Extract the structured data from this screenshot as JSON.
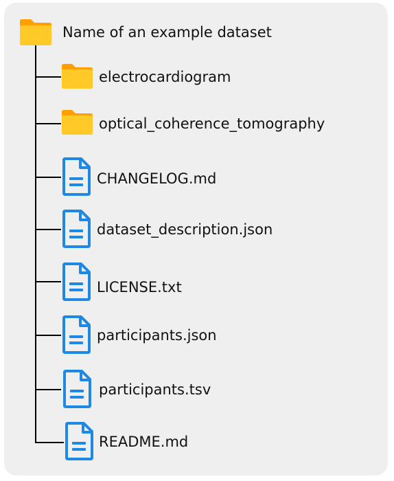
{
  "root": {
    "label": "Name of an example dataset",
    "icon": "folder-icon"
  },
  "entries": [
    {
      "label": "electrocardiogram",
      "icon": "folder-icon"
    },
    {
      "label": "optical_coherence_tomography",
      "icon": "folder-icon"
    },
    {
      "label": "CHANGELOG.md",
      "icon": "document-icon"
    },
    {
      "label": "dataset_description.json",
      "icon": "document-icon"
    },
    {
      "label": "LICENSE.txt",
      "icon": "document-icon"
    },
    {
      "label": "participants.json",
      "icon": "document-icon"
    },
    {
      "label": "participants.tsv",
      "icon": "document-icon"
    },
    {
      "label": "README.md",
      "icon": "document-icon"
    }
  ],
  "colors": {
    "panel": "#efefef",
    "folder_front": "#ffca28",
    "folder_back": "#ffa000",
    "document": "#1e88e5"
  }
}
